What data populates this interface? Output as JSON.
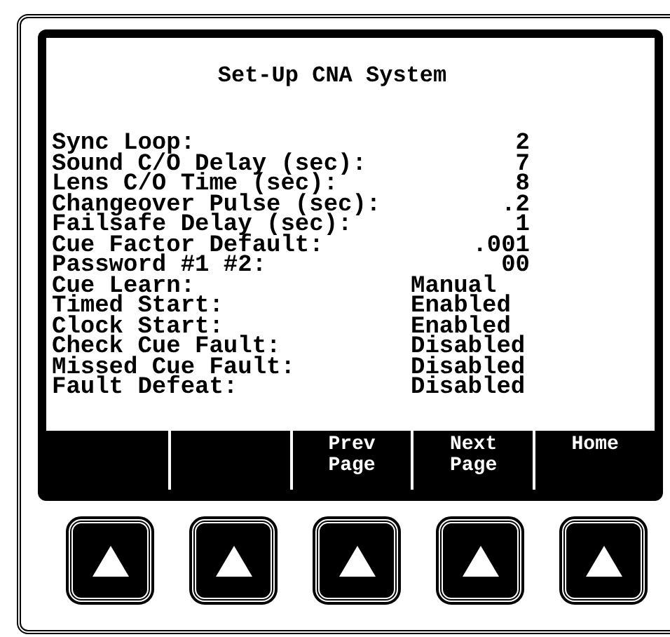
{
  "screen": {
    "title": "Set-Up CNA System",
    "settings": [
      {
        "label": "Sync Loop:",
        "value": "2",
        "kind": "number"
      },
      {
        "label": "Sound C/O Delay (sec):",
        "value": "7",
        "kind": "number"
      },
      {
        "label": "Lens C/O Time (sec):",
        "value": "8",
        "kind": "number"
      },
      {
        "label": "Changeover Pulse (sec):",
        "value": ".2",
        "kind": "number"
      },
      {
        "label": "Failsafe Delay (sec):",
        "value": "1",
        "kind": "number"
      },
      {
        "label": "Cue Factor Default:",
        "value": ".001",
        "kind": "number"
      },
      {
        "label": "Password #1 #2:",
        "value": "00",
        "kind": "number"
      },
      {
        "label": "Cue Learn:",
        "value": "Manual",
        "kind": "text"
      },
      {
        "label": "Timed Start:",
        "value": "Enabled",
        "kind": "text"
      },
      {
        "label": "Clock Start:",
        "value": "Enabled",
        "kind": "text"
      },
      {
        "label": "Check Cue Fault:",
        "value": "Disabled",
        "kind": "text"
      },
      {
        "label": "Missed Cue Fault:",
        "value": "Disabled",
        "kind": "text"
      },
      {
        "label": "Fault Defeat:",
        "value": "Disabled",
        "kind": "text"
      }
    ],
    "softkeys": [
      {
        "lines": [
          "Prev",
          "Page"
        ]
      },
      {
        "lines": [
          "Next",
          "Page"
        ]
      },
      {
        "lines": [
          "Home"
        ]
      }
    ]
  }
}
